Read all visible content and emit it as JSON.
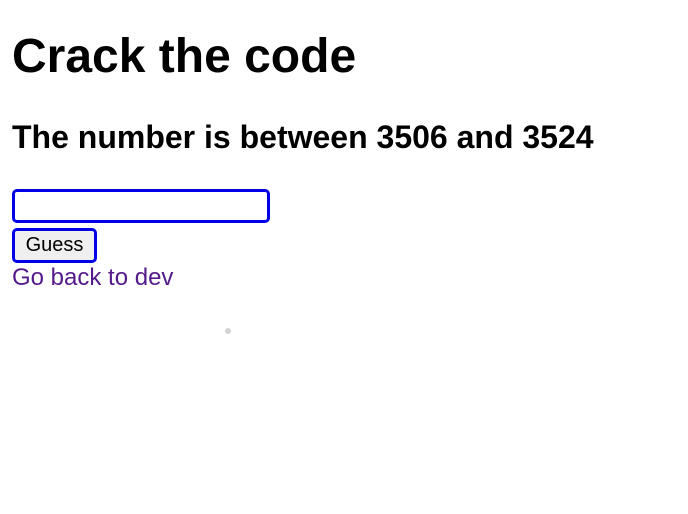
{
  "title": "Crack the code",
  "hint": "The number is between 3506 and 3524",
  "form": {
    "input_value": "",
    "button_label": "Guess"
  },
  "back_link": "Go back to dev",
  "colors": {
    "focus_border": "#0000e6",
    "link_visited": "#551a8b",
    "button_bg": "#efefef",
    "dot": "#d3d3d3"
  }
}
